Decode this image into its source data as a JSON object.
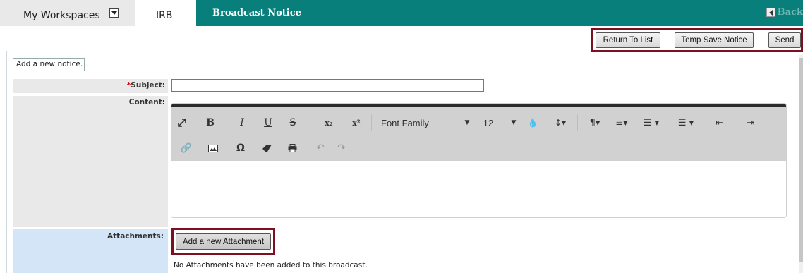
{
  "topbar": {
    "workspaces_label": "My Workspaces",
    "site_tab": "IRB",
    "tool_title": "Broadcast Notice",
    "back_label": "Back"
  },
  "actions": {
    "return_label": "Return To List",
    "temp_save_label": "Temp Save Notice",
    "send_label": "Send"
  },
  "notice": {
    "mode_label": "Add a new notice."
  },
  "form": {
    "subject_required_mark": "*",
    "subject_label": "Subject:",
    "subject_value": "",
    "content_label": "Content:",
    "attachments_label": "Attachments:",
    "add_attachment_label": "Add a new Attachment",
    "no_attachments_text": "No Attachments have been added to this broadcast."
  },
  "editor": {
    "font_family": "Font Family",
    "font_size": "12",
    "toolbar_row1": [
      "fullscreen-icon",
      "bold-icon",
      "italic-icon",
      "underline-icon",
      "strikethrough-icon",
      "subscript-icon",
      "superscript-icon",
      "font-family-select",
      "font-size-select",
      "text-color-icon",
      "line-height-icon",
      "paragraph-format-icon",
      "align-icon",
      "ordered-list-icon",
      "unordered-list-icon",
      "outdent-icon",
      "indent-icon"
    ],
    "toolbar_row2": [
      "link-icon",
      "image-icon",
      "special-characters-icon",
      "clear-formatting-icon",
      "print-icon",
      "undo-icon",
      "redo-icon"
    ],
    "glyphs": {
      "bold": "B",
      "italic": "I",
      "underline": "U",
      "strike": "S",
      "sub": "x₂",
      "sup": "x²",
      "omega": "Ω"
    }
  },
  "colors": {
    "teal": "#087f7a",
    "highlight": "#7a1020",
    "attach_row": "#d4e5f7"
  }
}
